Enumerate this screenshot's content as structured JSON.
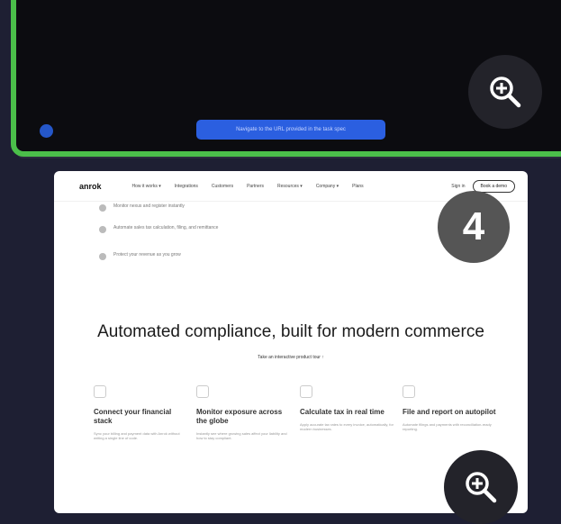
{
  "top_card": {
    "action_label": "Navigate to the URL provided in the task spec"
  },
  "screenshot": {
    "nav": {
      "logo": "anrok",
      "items": [
        "How it works ▾",
        "Integrations",
        "Customers",
        "Partners",
        "Resources ▾",
        "Company ▾",
        "Plans"
      ],
      "sign_in": "Sign in",
      "cta": "Book a demo"
    },
    "checklist": [
      "Monitor nexus and register instantly",
      "Automate sales tax calculation, filing, and remittance",
      "Protect your revenue as you grow"
    ],
    "headline": "Automated compliance, built for modern commerce",
    "subline": "Take an interactive product tour ↑",
    "features": [
      {
        "title": "Connect your financial stack",
        "desc": "Sync your billing and payment data with Anrok without writing a single line of code."
      },
      {
        "title": "Monitor exposure across the globe",
        "desc": "Instantly see where growing sales affect your liability and how to stay compliant."
      },
      {
        "title": "Calculate tax in real time",
        "desc": "Apply accurate tax rates to every invoice, automatically, for modern businesses."
      },
      {
        "title": "File and report on autopilot",
        "desc": "Automate filings and payments with reconciliation-ready reporting."
      }
    ]
  },
  "step_badge": "4",
  "colors": {
    "selected_border": "#4bbf4a",
    "action_pill": "#2b5fe0",
    "background": "#1e1f33"
  }
}
